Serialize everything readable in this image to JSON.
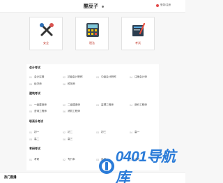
{
  "header": {
    "brand": "酷豆子",
    "login_label": "登录/注册"
  },
  "categories": [
    {
      "label": "安全",
      "icon": "tools-icon"
    },
    {
      "label": "税法",
      "icon": "calculator-icon"
    },
    {
      "label": "考试",
      "icon": "book-pen-icon"
    }
  ],
  "sections": [
    {
      "title": "会计考试",
      "items": [
        {
          "num": "01",
          "name": "会计实操"
        },
        {
          "num": "02",
          "name": "初级会计职称"
        },
        {
          "num": "03",
          "name": "中级会计职称"
        },
        {
          "num": "04",
          "name": "注册会计师"
        },
        {
          "num": "05",
          "name": "经济师"
        },
        {
          "num": "06",
          "name": "税务师"
        }
      ]
    },
    {
      "title": "建筑考试",
      "items": [
        {
          "num": "01",
          "name": "一级建造师"
        },
        {
          "num": "02",
          "name": "二级建造师"
        },
        {
          "num": "03",
          "name": "监理工程师"
        },
        {
          "num": "04",
          "name": "造价工程师"
        },
        {
          "num": "05",
          "name": "咨询工程师"
        },
        {
          "num": "06",
          "name": "消防工程师"
        }
      ]
    },
    {
      "title": "职高升考试",
      "items": [
        {
          "num": "01",
          "name": "初一"
        },
        {
          "num": "02",
          "name": "初二"
        },
        {
          "num": "03",
          "name": "初三"
        },
        {
          "num": "04",
          "name": "高一"
        },
        {
          "num": "05",
          "name": "高二"
        },
        {
          "num": "06",
          "name": "高三"
        }
      ]
    },
    {
      "title": "考研考试",
      "items": [
        {
          "num": "01",
          "name": "考研"
        },
        {
          "num": "02",
          "name": "专升本"
        },
        {
          "num": "03",
          "name": "自考"
        },
        {
          "num": "04",
          "name": "成考"
        }
      ]
    }
  ],
  "hotlist": {
    "title": "热门直播"
  },
  "watermark": {
    "text": "0401导航库"
  }
}
